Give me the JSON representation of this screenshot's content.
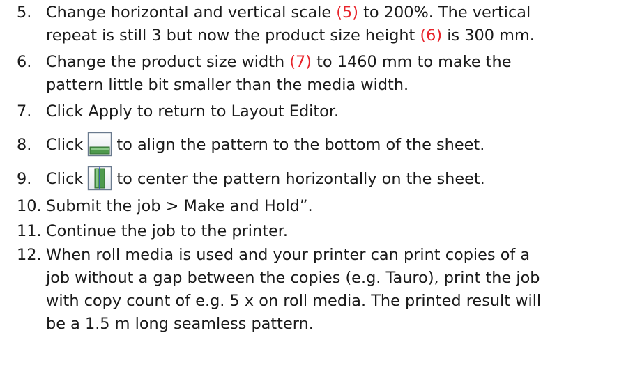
{
  "steps": [
    {
      "num": "5.",
      "lines": [
        {
          "a": "Change horizontal and vertical scale ",
          "ref": "(5)",
          "b": " to 200%. The vertical"
        },
        {
          "a": "repeat is still 3 but now the product size height ",
          "ref": "(6)",
          "b": " is 300 mm."
        }
      ]
    },
    {
      "num": "6.",
      "lines": [
        {
          "a": "Change the product size width ",
          "ref": "(7)",
          "b": " to 1460 mm to make the"
        },
        {
          "a": "pattern little bit smaller than the media width."
        }
      ]
    },
    {
      "num": "7.",
      "lines": [
        {
          "a": "Click Apply to return to Layout Editor."
        }
      ]
    },
    {
      "num": "8.",
      "before_icon": "Click",
      "icon": "align-bottom-icon",
      "after_icon": "to align the pattern to the bottom of the sheet."
    },
    {
      "num": "9.",
      "before_icon": "Click",
      "icon": "center-horizontal-icon",
      "after_icon": "to center the pattern horizontally on the sheet."
    },
    {
      "num": "10.",
      "lines": [
        {
          "a": "Submit the job > Make and Hold”."
        }
      ]
    },
    {
      "num": "11.",
      "lines": [
        {
          "a": "Continue the job to the printer."
        }
      ]
    },
    {
      "num": "12.",
      "lines": [
        {
          "a": "When roll media is used and your printer can print copies of a"
        },
        {
          "a": "job without a gap between the copies (e.g. Tauro), print the job"
        },
        {
          "a": "with copy count of e.g. 5 x on roll media. The printed result will"
        },
        {
          "a": "be a 1.5 m long seamless pattern."
        }
      ]
    }
  ],
  "colors": {
    "reference": "#e8242b",
    "text": "#1a1a1a"
  }
}
